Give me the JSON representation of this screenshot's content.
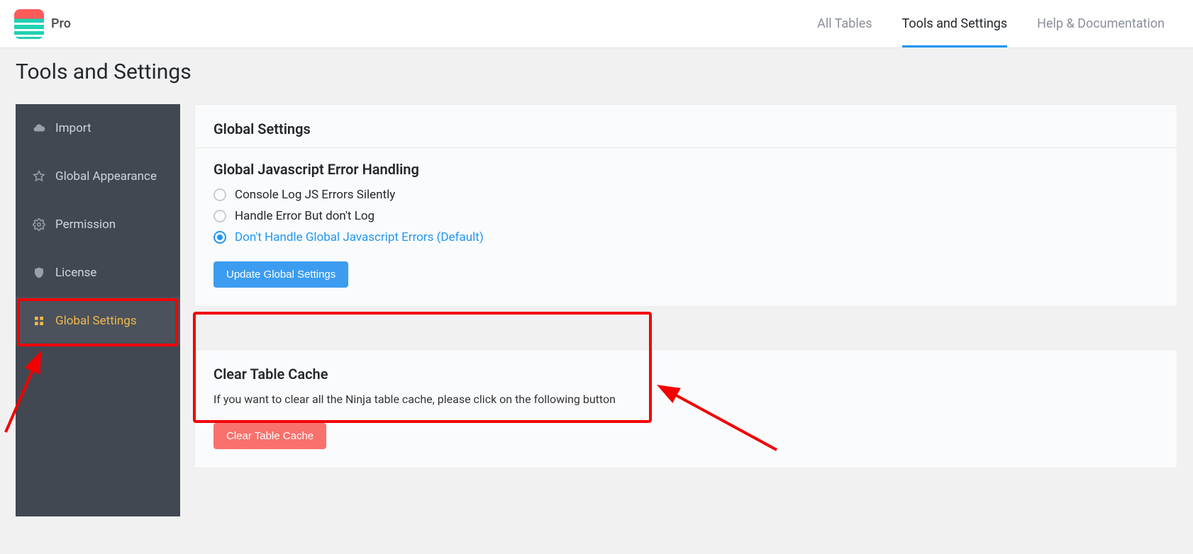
{
  "brand": {
    "label": "Pro"
  },
  "topnav": {
    "items": [
      {
        "label": "All Tables",
        "active": false
      },
      {
        "label": "Tools and Settings",
        "active": true
      },
      {
        "label": "Help & Documentation",
        "active": false
      }
    ]
  },
  "page": {
    "title": "Tools and Settings"
  },
  "sidebar": {
    "items": [
      {
        "label": "Import",
        "icon": "cloud"
      },
      {
        "label": "Global Appearance",
        "icon": "star"
      },
      {
        "label": "Permission",
        "icon": "gear"
      },
      {
        "label": "License",
        "icon": "shield"
      },
      {
        "label": "Global Settings",
        "icon": "grid",
        "active": true
      }
    ]
  },
  "globalSettings": {
    "title": "Global Settings",
    "errorSection": {
      "title": "Global Javascript Error Handling",
      "options": [
        {
          "label": "Console Log JS Errors Silently",
          "selected": false
        },
        {
          "label": "Handle Error But don't Log",
          "selected": false
        },
        {
          "label": "Don't Handle Global Javascript Errors (Default)",
          "selected": true
        }
      ],
      "button": "Update Global Settings"
    },
    "cacheSection": {
      "title": "Clear Table Cache",
      "description": "If you want to clear all the Ninja table cache, please click on the following button",
      "button": "Clear Table Cache"
    }
  }
}
